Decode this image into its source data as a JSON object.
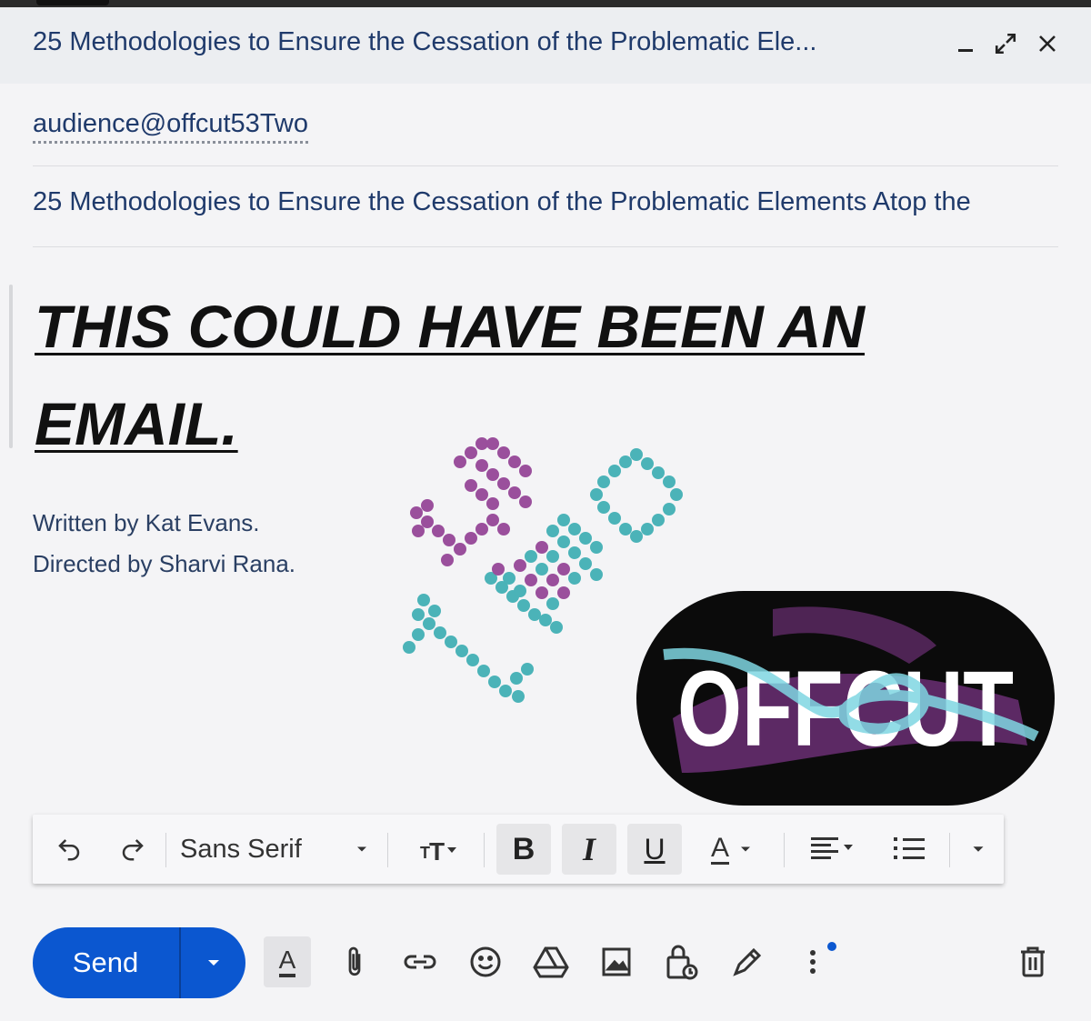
{
  "window": {
    "title": "25 Methodologies to Ensure the Cessation of the Problematic Ele...",
    "controls": [
      "minimize-icon",
      "expand-icon",
      "close-icon"
    ]
  },
  "recipient": "audience@offcut53Two",
  "subject": "25 Methodologies to Ensure the Cessation of the Problematic Elements Atop the",
  "body": {
    "headline_line1": "THIS COULD HAVE BEEN AN",
    "headline_line2": "EMAIL.",
    "credit_written": "Written by Kat Evans.",
    "credit_directed": "Directed by Sharvi Rana."
  },
  "logos": {
    "fifty_three_two": {
      "name": "53 two dotted logo",
      "colors": {
        "purple": "#9a4f9c",
        "teal": "#4bb3b8"
      }
    },
    "offcut": {
      "text": "OFFCUT",
      "colors": {
        "background": "#0b0b0b",
        "brush": "#6b2f74",
        "text": "#ffffff",
        "scribble": "#7fd6e2"
      }
    }
  },
  "toolbar": {
    "font_name": "Sans Serif",
    "icons": [
      "undo-icon",
      "redo-icon",
      "font-dropdown-icon",
      "text-size-icon",
      "bold-icon",
      "italic-icon",
      "underline-icon",
      "text-color-icon",
      "align-icon",
      "numbered-list-icon",
      "more-formatting-icon"
    ],
    "bold_glyph": "B",
    "italic_glyph": "I",
    "underline_glyph": "U",
    "textcolor_glyph": "A"
  },
  "bottom_bar": {
    "send_label": "Send",
    "format_glyph": "A",
    "icons": [
      "formatting-toggle-icon",
      "attach-icon",
      "link-icon",
      "emoji-icon",
      "drive-icon",
      "photo-icon",
      "confidential-lock-icon",
      "signature-pen-icon",
      "more-options-icon",
      "trash-icon"
    ]
  },
  "colors": {
    "accent": "#0b57d0",
    "link_text": "#1f3a6b"
  }
}
